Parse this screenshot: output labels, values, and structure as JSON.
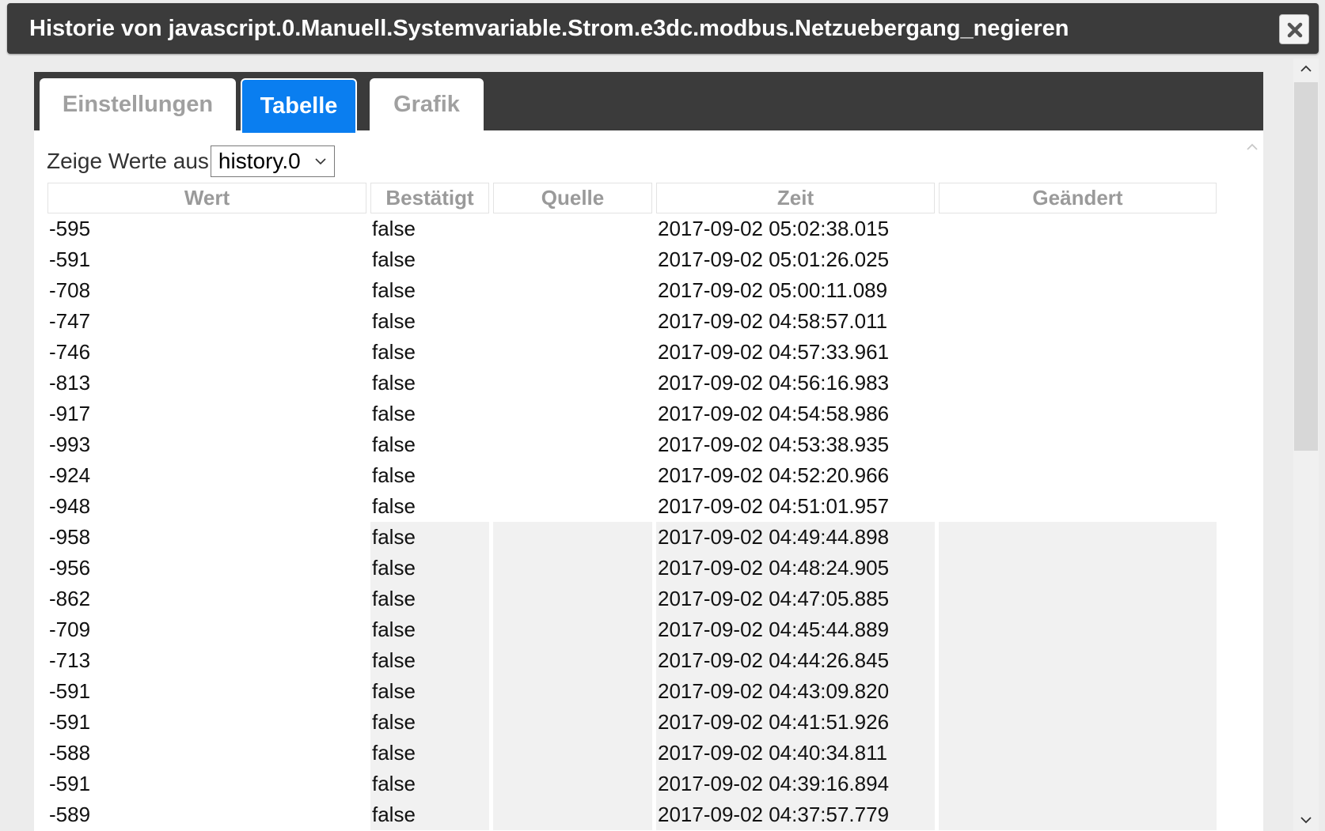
{
  "dialog": {
    "title": "Historie von javascript.0.Manuell.Systemvariable.Strom.e3dc.modbus.Netzuebergang_negieren",
    "close_icon": "close-icon"
  },
  "tabs": [
    {
      "label": "Einstellungen",
      "active": false
    },
    {
      "label": "Tabelle",
      "active": true
    },
    {
      "label": "Grafik",
      "active": false
    }
  ],
  "source": {
    "label": "Zeige Werte aus",
    "selected": "history.0"
  },
  "table": {
    "columns": [
      "Wert",
      "Bestätigt",
      "Quelle",
      "Zeit",
      "Geändert"
    ],
    "rows": [
      {
        "wert": "-595",
        "bestaetigt": "false",
        "quelle": "",
        "zeit": "2017-09-02 05:02:38.015",
        "geaendert": ""
      },
      {
        "wert": "-591",
        "bestaetigt": "false",
        "quelle": "",
        "zeit": "2017-09-02 05:01:26.025",
        "geaendert": ""
      },
      {
        "wert": "-708",
        "bestaetigt": "false",
        "quelle": "",
        "zeit": "2017-09-02 05:00:11.089",
        "geaendert": ""
      },
      {
        "wert": "-747",
        "bestaetigt": "false",
        "quelle": "",
        "zeit": "2017-09-02 04:58:57.011",
        "geaendert": ""
      },
      {
        "wert": "-746",
        "bestaetigt": "false",
        "quelle": "",
        "zeit": "2017-09-02 04:57:33.961",
        "geaendert": ""
      },
      {
        "wert": "-813",
        "bestaetigt": "false",
        "quelle": "",
        "zeit": "2017-09-02 04:56:16.983",
        "geaendert": ""
      },
      {
        "wert": "-917",
        "bestaetigt": "false",
        "quelle": "",
        "zeit": "2017-09-02 04:54:58.986",
        "geaendert": ""
      },
      {
        "wert": "-993",
        "bestaetigt": "false",
        "quelle": "",
        "zeit": "2017-09-02 04:53:38.935",
        "geaendert": ""
      },
      {
        "wert": "-924",
        "bestaetigt": "false",
        "quelle": "",
        "zeit": "2017-09-02 04:52:20.966",
        "geaendert": ""
      },
      {
        "wert": "-948",
        "bestaetigt": "false",
        "quelle": "",
        "zeit": "2017-09-02 04:51:01.957",
        "geaendert": ""
      },
      {
        "wert": "-958",
        "bestaetigt": "false",
        "quelle": "",
        "zeit": "2017-09-02 04:49:44.898",
        "geaendert": ""
      },
      {
        "wert": "-956",
        "bestaetigt": "false",
        "quelle": "",
        "zeit": "2017-09-02 04:48:24.905",
        "geaendert": ""
      },
      {
        "wert": "-862",
        "bestaetigt": "false",
        "quelle": "",
        "zeit": "2017-09-02 04:47:05.885",
        "geaendert": ""
      },
      {
        "wert": "-709",
        "bestaetigt": "false",
        "quelle": "",
        "zeit": "2017-09-02 04:45:44.889",
        "geaendert": ""
      },
      {
        "wert": "-713",
        "bestaetigt": "false",
        "quelle": "",
        "zeit": "2017-09-02 04:44:26.845",
        "geaendert": ""
      },
      {
        "wert": "-591",
        "bestaetigt": "false",
        "quelle": "",
        "zeit": "2017-09-02 04:43:09.820",
        "geaendert": ""
      },
      {
        "wert": "-591",
        "bestaetigt": "false",
        "quelle": "",
        "zeit": "2017-09-02 04:41:51.926",
        "geaendert": ""
      },
      {
        "wert": "-588",
        "bestaetigt": "false",
        "quelle": "",
        "zeit": "2017-09-02 04:40:34.811",
        "geaendert": ""
      },
      {
        "wert": "-591",
        "bestaetigt": "false",
        "quelle": "",
        "zeit": "2017-09-02 04:39:16.894",
        "geaendert": ""
      },
      {
        "wert": "-589",
        "bestaetigt": "false",
        "quelle": "",
        "zeit": "2017-09-02 04:37:57.779",
        "geaendert": ""
      }
    ]
  },
  "colors": {
    "titlebar": "#3b3b3b",
    "active_tab": "#0a7ef0",
    "inactive_tab_text": "#a0a0a0"
  },
  "icons": {
    "close": "close-icon",
    "dropdown": "chevron-down-icon",
    "scroll_up": "chevron-up-icon",
    "scroll_down": "chevron-down-icon"
  }
}
